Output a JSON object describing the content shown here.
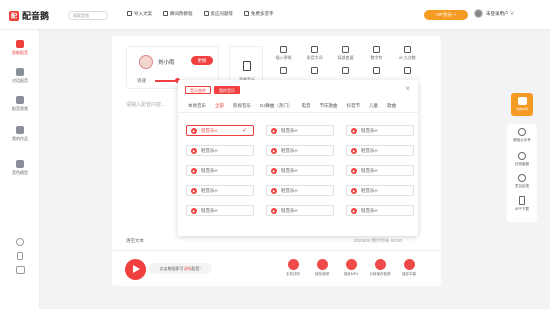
{
  "app": {
    "logo_mark": "配",
    "name": "配音鹅"
  },
  "search": {
    "placeholder": "搜索音频"
  },
  "topnav": [
    {
      "label": "导入文案",
      "icon": "import-icon"
    },
    {
      "label": "瞬间改教程",
      "icon": "tutorial-icon"
    },
    {
      "label": "反应问题等",
      "icon": "feedback-icon"
    },
    {
      "label": "免费多音字",
      "icon": "polyphone-icon"
    }
  ],
  "vip": {
    "label": "VIP会员 >"
  },
  "user": {
    "name": "未登录用户 ∨"
  },
  "sidebar": [
    {
      "label": "智能配音",
      "icon": "mic-icon",
      "active": true
    },
    {
      "label": "对话配音",
      "icon": "users-icon",
      "active": false
    },
    {
      "label": "配音视频",
      "icon": "video-icon",
      "active": false
    },
    {
      "label": "我的作品",
      "icon": "folder-icon",
      "active": false
    },
    {
      "label": "音色模型",
      "icon": "model-icon",
      "active": false
    }
  ],
  "voice": {
    "name": "刘小雨",
    "change_label": "更换",
    "speed_label": "语速"
  },
  "bgm": {
    "label": "背景音乐"
  },
  "tools": [
    {
      "label": "插入停顿",
      "icon": "pause-icon"
    },
    {
      "label": "多音字词",
      "icon": "polyphone-icon"
    },
    {
      "label": "局部变速",
      "icon": "speed-icon"
    },
    {
      "label": "数字符",
      "icon": "number-icon"
    },
    {
      "label": "6f 九点数",
      "icon": "symbol-icon"
    },
    {
      "label": "",
      "icon": "ruler-icon"
    },
    {
      "label": "",
      "icon": "person-icon"
    },
    {
      "label": "",
      "icon": "chat-icon"
    },
    {
      "label": "",
      "icon": "headphone-icon"
    },
    {
      "label": "",
      "icon": "mark-icon"
    }
  ],
  "editor": {
    "placeholder": "请输入配音内容...",
    "clear_label": "清空文本",
    "count": "0/10000  预计时长 00:00"
  },
  "panel": {
    "tabs": [
      {
        "label": "音乐曲库",
        "active": false
      },
      {
        "label": "我的音乐",
        "active": true
      }
    ],
    "close": "×",
    "categories": [
      "本地音乐",
      "全部",
      "影视音乐",
      "DJ舞曲（热门）",
      "电音",
      "节庆歌曲",
      "抖音节",
      "儿童",
      "歌曲"
    ],
    "active_category": "全部",
    "items": [
      "轻音乐A",
      "轻音乐A",
      "轻音乐A",
      "轻音乐A",
      "轻音乐A",
      "轻音乐A",
      "轻音乐A",
      "轻音乐A",
      "轻音乐A",
      "轻音乐A",
      "轻音乐A",
      "轻音乐A",
      "轻音乐A",
      "轻音乐A",
      "轻音乐A"
    ],
    "selected_index": 0,
    "check": "✓"
  },
  "bottom": {
    "hint_prefix": "点击按钮即可",
    "hint_highlight": "试听",
    "hint_suffix": "配音~",
    "actions": [
      "手机试听",
      "保存音频",
      "保存MP4",
      "分段保存音频",
      "保存字幕"
    ]
  },
  "right": {
    "badge": "去掉水印",
    "items": [
      "微信公众号",
      "在线客服",
      "意见反馈",
      "APP下载"
    ]
  },
  "colors": {
    "accent": "#ef3f3f",
    "vip": "#f59a23"
  }
}
